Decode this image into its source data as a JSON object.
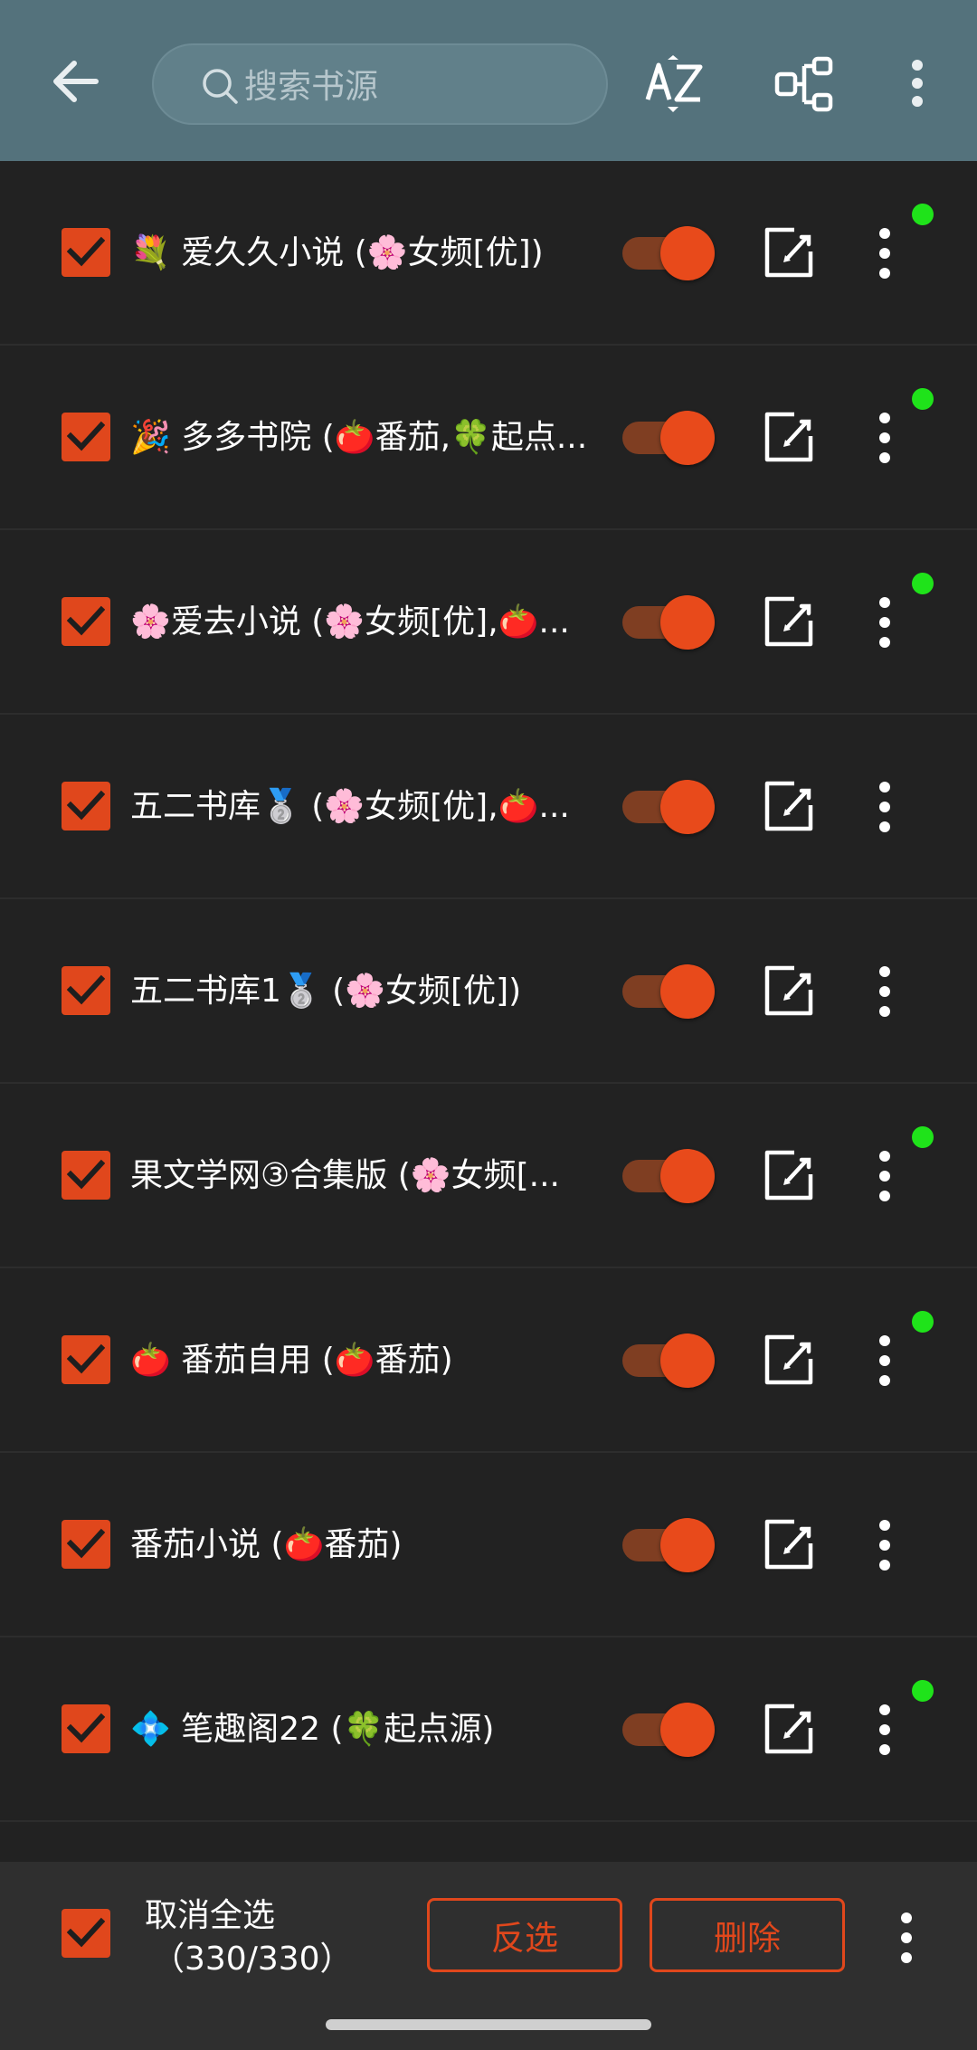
{
  "toolbar": {
    "search_placeholder": "搜索书源",
    "back_icon": "arrow-left-icon",
    "sort_icon": "sort-az-icon",
    "group_icon": "group-icon",
    "more_icon": "more-vertical-icon"
  },
  "sources": [
    {
      "title": "💐 爱久久小说 (🌸女频[优])",
      "enabled": true,
      "checked": true,
      "status_dot": true
    },
    {
      "title": "🎉 多多书院 (🍅番茄,🍀起点...",
      "enabled": true,
      "checked": true,
      "status_dot": true
    },
    {
      "title": "🌸爱去小说 (🌸女频[优],🍅...",
      "enabled": true,
      "checked": true,
      "status_dot": true
    },
    {
      "title": "五二书库🥈 (🌸女频[优],🍅...",
      "enabled": true,
      "checked": true,
      "status_dot": false
    },
    {
      "title": "五二书库1🥈 (🌸女频[优])",
      "enabled": true,
      "checked": true,
      "status_dot": false
    },
    {
      "title": "果文学网③合集版 (🌸女频[...",
      "enabled": true,
      "checked": true,
      "status_dot": true
    },
    {
      "title": "🍅 番茄自用 (🍅番茄)",
      "enabled": true,
      "checked": true,
      "status_dot": true
    },
    {
      "title": "番茄小说 (🍅番茄)",
      "enabled": true,
      "checked": true,
      "status_dot": false
    },
    {
      "title": "💠 笔趣阁22 (🍀起点源)",
      "enabled": true,
      "checked": true,
      "status_dot": true
    }
  ],
  "bottom": {
    "select_label": "取消全选",
    "count": "（330/330）",
    "invert_label": "反选",
    "delete_label": "删除"
  },
  "colors": {
    "accent": "#e0471c",
    "toolbar": "#54727c",
    "background": "#222222",
    "status_dot": "#1fe31a"
  }
}
